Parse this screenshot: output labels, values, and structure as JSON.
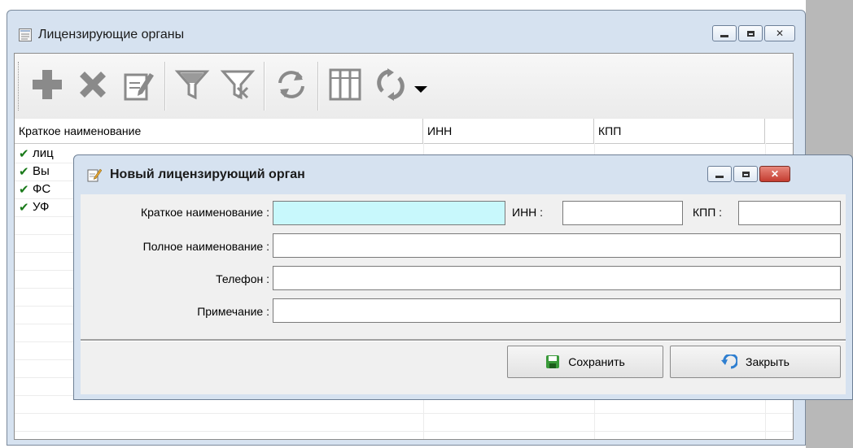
{
  "main_window": {
    "title": "Лицензирующие органы",
    "icons": [
      "app-list-icon",
      "minimize-icon",
      "maximize-icon",
      "close-icon"
    ]
  },
  "toolbar": {
    "buttons": [
      "add-icon",
      "delete-icon",
      "edit-icon",
      "filter-icon",
      "clear-filter-icon",
      "refresh-icon",
      "columns-icon",
      "sync-icon",
      "dropdown-arrow-icon"
    ]
  },
  "grid": {
    "columns": [
      "Краткое наименование",
      "ИНН",
      "КПП"
    ],
    "rows": [
      {
        "name": "лиц",
        "checked": true
      },
      {
        "name": "Вы",
        "checked": true
      },
      {
        "name": "ФС",
        "checked": true
      },
      {
        "name": "УФ",
        "checked": true
      }
    ]
  },
  "dialog": {
    "title": "Новый лицензирующий орган",
    "fields": {
      "short_name_label": "Краткое наименование :",
      "inn_label": "ИНН :",
      "kpp_label": "КПП :",
      "full_name_label": "Полное наименование :",
      "phone_label": "Телефон :",
      "note_label": "Примечание :",
      "short_name_value": "",
      "inn_value": "",
      "kpp_value": "",
      "full_name_value": "",
      "phone_value": "",
      "note_value": ""
    },
    "buttons": {
      "save_label": "Сохранить",
      "close_label": "Закрыть"
    }
  },
  "colors": {
    "frame": "#d6e2f0",
    "active_input": "#c8f8fc",
    "check": "#1a7a1a",
    "close_button": "#c9463d"
  }
}
